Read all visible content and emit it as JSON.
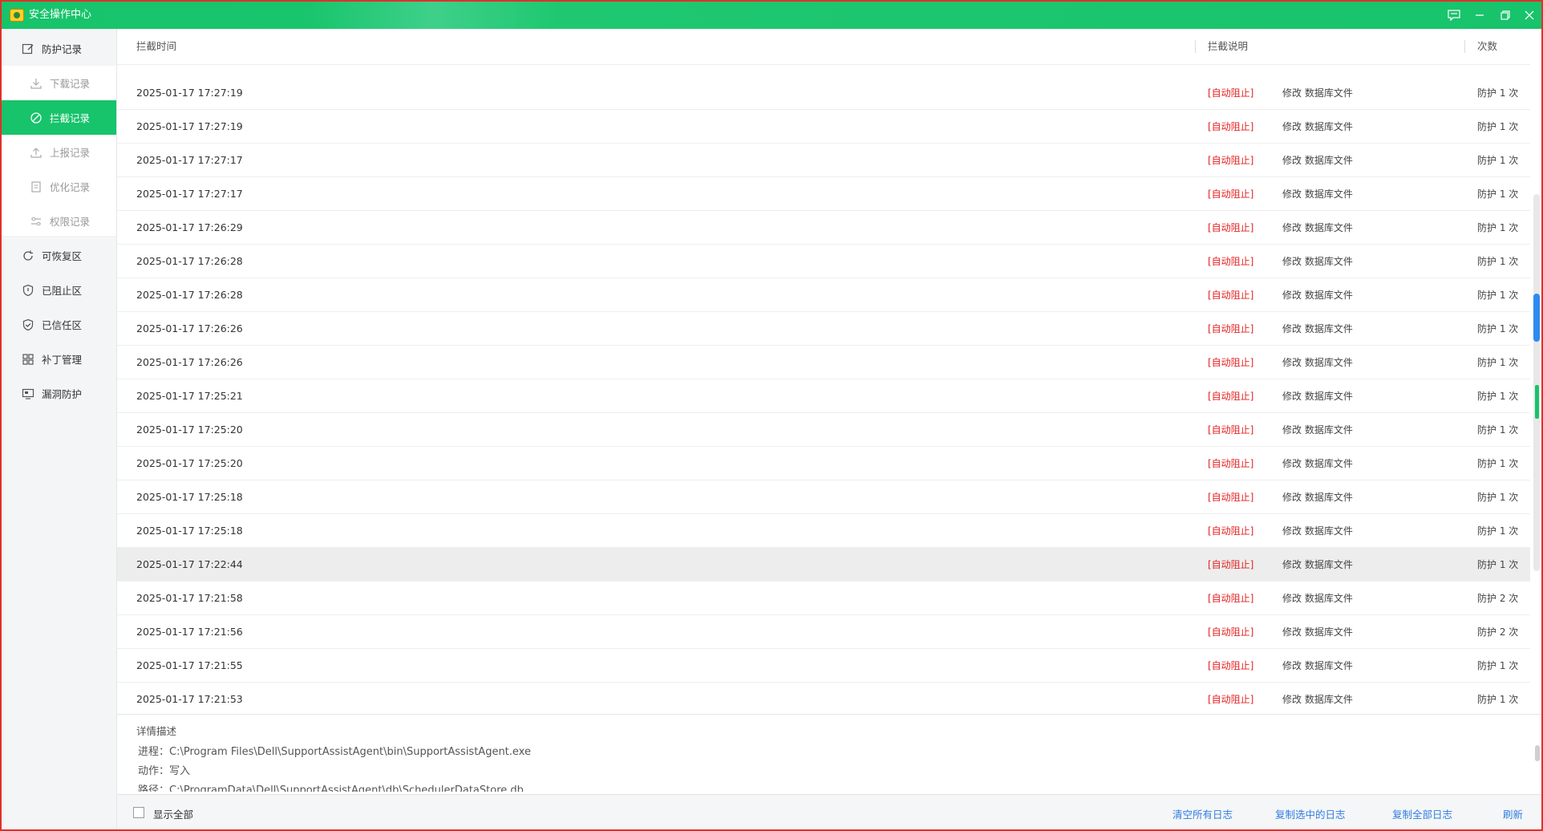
{
  "window": {
    "title": "安全操作中心"
  },
  "titlebar_icons": [
    "feedback-icon",
    "minimize-icon",
    "restore-icon",
    "close-icon"
  ],
  "sidebar": {
    "items": [
      {
        "label": "防护记录",
        "icon": "edit-icon",
        "level": "top"
      },
      {
        "label": "下载记录",
        "icon": "download-icon",
        "level": "sub"
      },
      {
        "label": "拦截记录",
        "icon": "block-icon",
        "level": "sub",
        "active": true
      },
      {
        "label": "上报记录",
        "icon": "upload-icon",
        "level": "sub"
      },
      {
        "label": "优化记录",
        "icon": "document-icon",
        "level": "sub"
      },
      {
        "label": "权限记录",
        "icon": "sliders-icon",
        "level": "sub"
      },
      {
        "label": "可恢复区",
        "icon": "refresh-icon",
        "level": "top"
      },
      {
        "label": "已阻止区",
        "icon": "shield-block-icon",
        "level": "top"
      },
      {
        "label": "已信任区",
        "icon": "shield-check-icon",
        "level": "top"
      },
      {
        "label": "补丁管理",
        "icon": "grid-icon",
        "level": "top"
      },
      {
        "label": "漏洞防护",
        "icon": "monitor-icon",
        "level": "top"
      }
    ]
  },
  "table": {
    "headers": {
      "time": "拦截时间",
      "desc": "拦截说明",
      "count": "次数"
    },
    "rows": [
      {
        "time": "2025-01-17 17:27:19",
        "badge": "[自动阻止]",
        "desc": "修改 数据库文件",
        "count": "防护 1 次"
      },
      {
        "time": "2025-01-17 17:27:19",
        "badge": "[自动阻止]",
        "desc": "修改 数据库文件",
        "count": "防护 1 次"
      },
      {
        "time": "2025-01-17 17:27:17",
        "badge": "[自动阻止]",
        "desc": "修改 数据库文件",
        "count": "防护 1 次"
      },
      {
        "time": "2025-01-17 17:27:17",
        "badge": "[自动阻止]",
        "desc": "修改 数据库文件",
        "count": "防护 1 次"
      },
      {
        "time": "2025-01-17 17:26:29",
        "badge": "[自动阻止]",
        "desc": "修改 数据库文件",
        "count": "防护 1 次"
      },
      {
        "time": "2025-01-17 17:26:28",
        "badge": "[自动阻止]",
        "desc": "修改 数据库文件",
        "count": "防护 1 次"
      },
      {
        "time": "2025-01-17 17:26:28",
        "badge": "[自动阻止]",
        "desc": "修改 数据库文件",
        "count": "防护 1 次"
      },
      {
        "time": "2025-01-17 17:26:26",
        "badge": "[自动阻止]",
        "desc": "修改 数据库文件",
        "count": "防护 1 次"
      },
      {
        "time": "2025-01-17 17:26:26",
        "badge": "[自动阻止]",
        "desc": "修改 数据库文件",
        "count": "防护 1 次"
      },
      {
        "time": "2025-01-17 17:25:21",
        "badge": "[自动阻止]",
        "desc": "修改 数据库文件",
        "count": "防护 1 次"
      },
      {
        "time": "2025-01-17 17:25:20",
        "badge": "[自动阻止]",
        "desc": "修改 数据库文件",
        "count": "防护 1 次"
      },
      {
        "time": "2025-01-17 17:25:20",
        "badge": "[自动阻止]",
        "desc": "修改 数据库文件",
        "count": "防护 1 次"
      },
      {
        "time": "2025-01-17 17:25:18",
        "badge": "[自动阻止]",
        "desc": "修改 数据库文件",
        "count": "防护 1 次"
      },
      {
        "time": "2025-01-17 17:25:18",
        "badge": "[自动阻止]",
        "desc": "修改 数据库文件",
        "count": "防护 1 次"
      },
      {
        "time": "2025-01-17 17:22:44",
        "badge": "[自动阻止]",
        "desc": "修改 数据库文件",
        "count": "防护 1 次",
        "selected": true
      },
      {
        "time": "2025-01-17 17:21:58",
        "badge": "[自动阻止]",
        "desc": "修改 数据库文件",
        "count": "防护 2 次"
      },
      {
        "time": "2025-01-17 17:21:56",
        "badge": "[自动阻止]",
        "desc": "修改 数据库文件",
        "count": "防护 2 次"
      },
      {
        "time": "2025-01-17 17:21:55",
        "badge": "[自动阻止]",
        "desc": "修改 数据库文件",
        "count": "防护 1 次"
      },
      {
        "time": "2025-01-17 17:21:53",
        "badge": "[自动阻止]",
        "desc": "修改 数据库文件",
        "count": "防护 1 次"
      }
    ]
  },
  "detail": {
    "title": "详情描述",
    "process": "进程：C:\\Program Files\\Dell\\SupportAssistAgent\\bin\\SupportAssistAgent.exe",
    "action": "动作：写入",
    "path": "路径：C:\\ProgramData\\Dell\\SupportAssistAgent\\db\\SchedulerDataStore.db"
  },
  "footer": {
    "show_all": "显示全部",
    "clear_logs": "清空所有日志",
    "copy_selected": "复制选中的日志",
    "copy_all": "复制全部日志",
    "refresh": "刷新"
  },
  "colors": {
    "accent": "#17c36b",
    "danger": "#e42222",
    "link": "#2f7de1"
  }
}
